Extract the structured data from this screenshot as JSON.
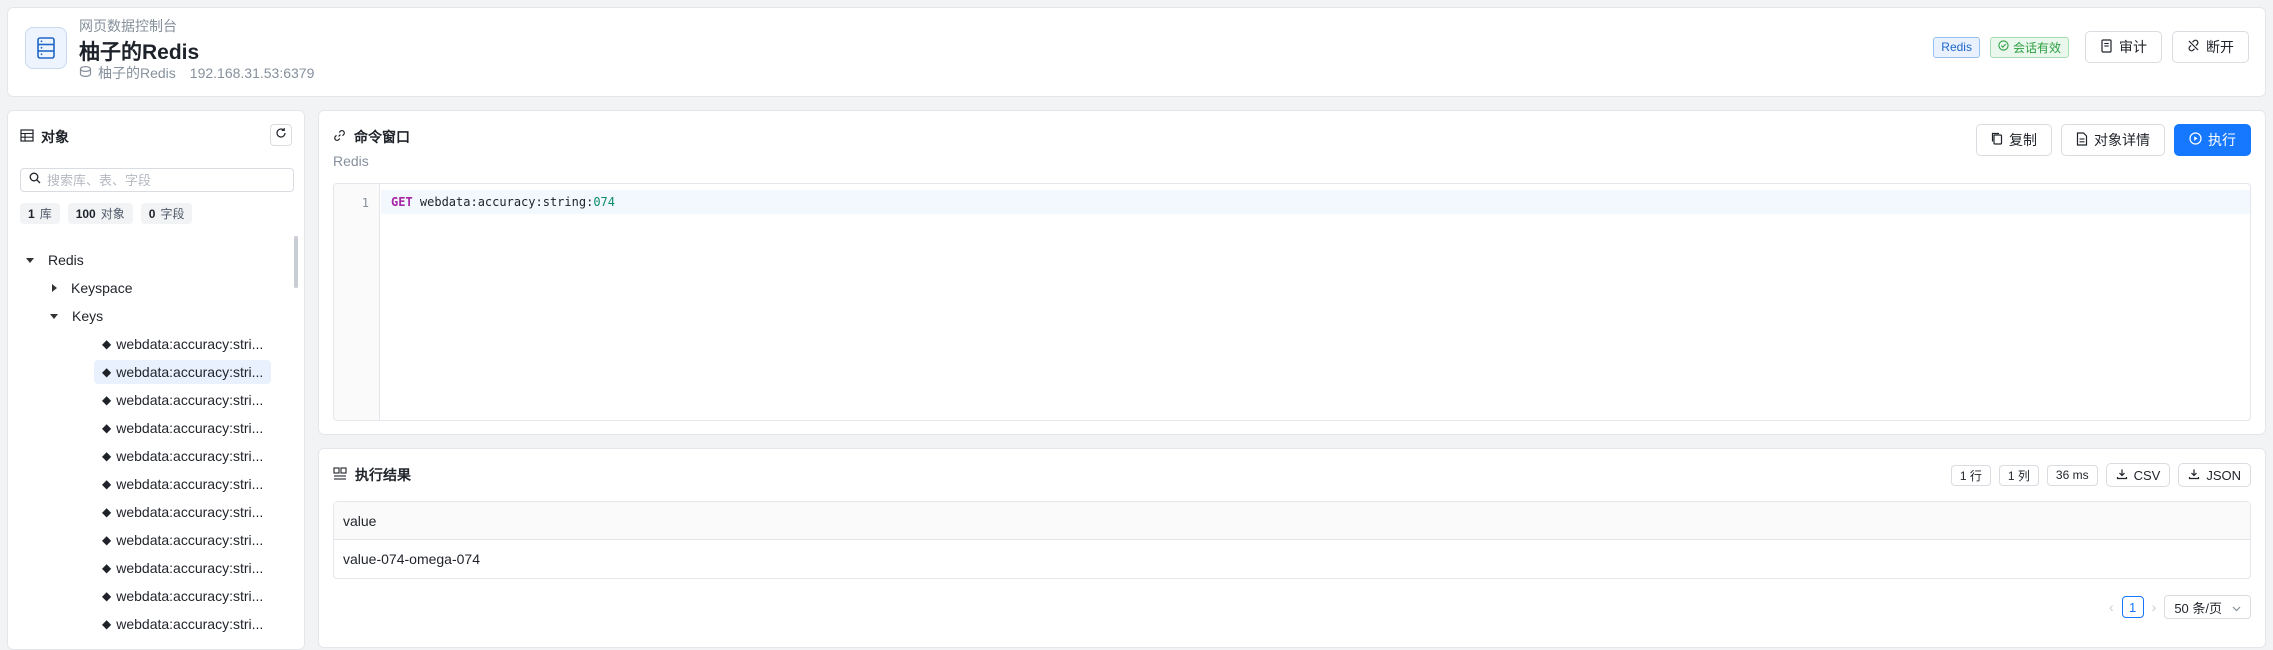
{
  "header": {
    "subtitle": "网页数据控制台",
    "title": "柚子的Redis",
    "connection_name": "柚子的Redis",
    "connection_address": "192.168.31.53:6379",
    "db_tag": "Redis",
    "session_tag": "会话有效",
    "audit_label": "审计",
    "disconnect_label": "断开"
  },
  "sidebar": {
    "title": "对象",
    "search_placeholder": "搜索库、表、字段",
    "stats": [
      {
        "count": "1",
        "unit": "库"
      },
      {
        "count": "100",
        "unit": "对象"
      },
      {
        "count": "0",
        "unit": "字段"
      }
    ],
    "tree": {
      "root": "Redis",
      "keyspace": "Keyspace",
      "keys": "Keys",
      "items": [
        "webdata:accuracy:stri...",
        "webdata:accuracy:stri...",
        "webdata:accuracy:stri...",
        "webdata:accuracy:stri...",
        "webdata:accuracy:stri...",
        "webdata:accuracy:stri...",
        "webdata:accuracy:stri...",
        "webdata:accuracy:stri...",
        "webdata:accuracy:stri...",
        "webdata:accuracy:stri...",
        "webdata:accuracy:stri..."
      ],
      "selected_index": 1
    }
  },
  "command": {
    "title": "命令窗口",
    "subtitle": "Redis",
    "copy_label": "复制",
    "detail_label": "对象详情",
    "run_label": "执行",
    "line_number": "1",
    "code_keyword": "GET",
    "code_key": " webdata:accuracy:string:",
    "code_num": "074"
  },
  "result": {
    "title": "执行结果",
    "rows_label": "1 行",
    "cols_label": "1 列",
    "time_label": "36 ms",
    "csv_label": "CSV",
    "json_label": "JSON",
    "column": "value",
    "cell": "value-074-omega-074",
    "page": "1",
    "page_size": "50 条/页"
  },
  "colors": {
    "primary": "#1677ff",
    "success": "#2ea043",
    "keyword": "#a626a4",
    "number": "#0b8a6a"
  }
}
